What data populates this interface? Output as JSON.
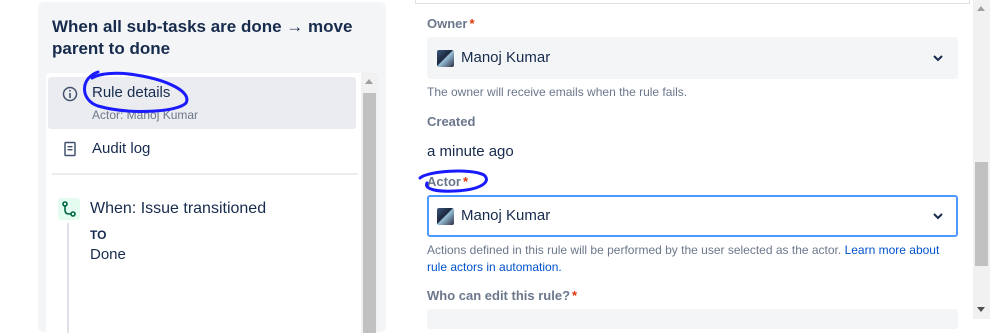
{
  "rule": {
    "title": "When all sub-tasks are done → move parent to done"
  },
  "nav": {
    "items": [
      {
        "label": "Rule details",
        "sub": "Actor: Manoj Kumar",
        "icon": "info-icon",
        "selected": true
      },
      {
        "label": "Audit log",
        "icon": "document-icon"
      }
    ],
    "trigger": {
      "label": "When: Issue transitioned",
      "to_label": "TO",
      "to_value": "Done",
      "icon": "branch-icon"
    }
  },
  "form": {
    "owner": {
      "label": "Owner",
      "required": "*",
      "value": "Manoj Kumar",
      "helper": "The owner will receive emails when the rule fails."
    },
    "created": {
      "label": "Created",
      "value": "a minute ago"
    },
    "actor": {
      "label": "Actor",
      "required": "*",
      "value": "Manoj Kumar",
      "helper": "Actions defined in this rule will be performed by the user selected as the actor.",
      "helper_link": "Learn more about rule actors in automation."
    },
    "edit_permission": {
      "label": "Who can edit this rule?",
      "required": "*"
    }
  },
  "colors": {
    "accent": "#0052cc",
    "focus_border": "#4c9aff",
    "required": "#de350b",
    "annotation": "#1a1aff"
  }
}
